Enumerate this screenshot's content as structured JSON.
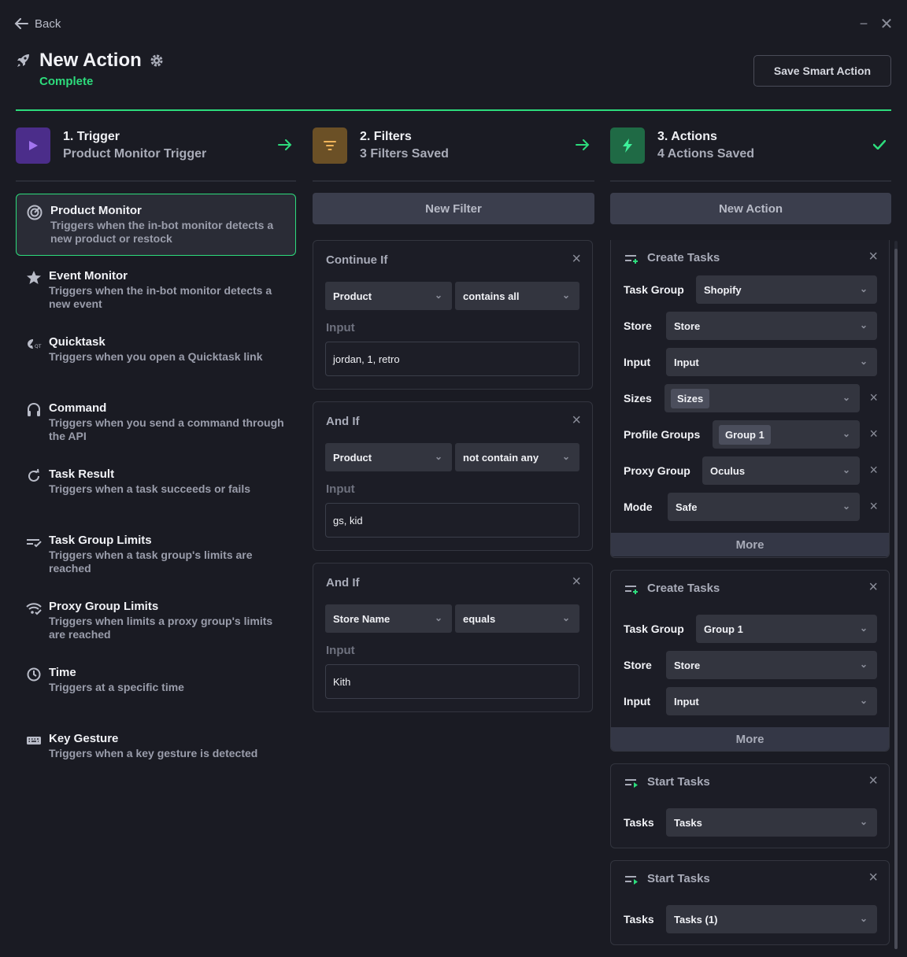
{
  "header": {
    "back_label": "Back",
    "title": "New Action",
    "status": "Complete",
    "save_label": "Save Smart Action",
    "minimize_glyph": "−",
    "close_glyph": "✕"
  },
  "steps": [
    {
      "title": "1. Trigger",
      "subtitle": "Product Monitor Trigger",
      "icon": "play-icon",
      "color": "#4b2d8a"
    },
    {
      "title": "2. Filters",
      "subtitle": "3 Filters Saved",
      "icon": "filter-icon",
      "color": "#6b5026"
    },
    {
      "title": "3. Actions",
      "subtitle": "4 Actions Saved",
      "icon": "bolt-icon",
      "color": "#1f6a45"
    }
  ],
  "triggers": [
    {
      "name": "Product Monitor",
      "description": "Triggers when the in-bot monitor detects a new product or restock",
      "icon": "target-icon",
      "selected": true
    },
    {
      "name": "Event Monitor",
      "description": "Triggers when the in-bot monitor detects a new event",
      "icon": "star-icon"
    },
    {
      "name": "Quicktask",
      "description": "Triggers when you open a Quicktask link",
      "icon": "quicktask-icon"
    },
    {
      "name": "Command",
      "description": "Triggers when you send a command through the API",
      "icon": "headset-icon"
    },
    {
      "name": "Task Result",
      "description": "Triggers when a task succeeds or fails",
      "icon": "refresh-icon"
    },
    {
      "name": "Task Group Limits",
      "description": "Triggers when a task group's limits are reached",
      "icon": "task-group-icon"
    },
    {
      "name": "Proxy Group Limits",
      "description": "Triggers when limits a proxy group's limits are reached",
      "icon": "wifi-icon"
    },
    {
      "name": "Time",
      "description": "Triggers at a specific time",
      "icon": "clock-icon"
    },
    {
      "name": "Key Gesture",
      "description": "Triggers when a key gesture is detected",
      "icon": "keyboard-icon"
    }
  ],
  "filters": {
    "new_label": "New Filter",
    "input_label": "Input",
    "items": [
      {
        "title": "Continue If",
        "field": "Product",
        "operator": "contains all",
        "value": "jordan, 1, retro"
      },
      {
        "title": "And If",
        "field": "Product",
        "operator": "not contain any",
        "value": "gs, kid"
      },
      {
        "title": "And If",
        "field": "Store Name",
        "operator": "equals",
        "value": "Kith"
      }
    ]
  },
  "actions": {
    "new_label": "New Action",
    "more_label": "More",
    "card1": {
      "title": "Create Tasks",
      "task_group_label": "Task Group",
      "task_group": "Shopify",
      "store_label": "Store",
      "store": "Store",
      "input_label": "Input",
      "input": "Input",
      "sizes_label": "Sizes",
      "sizes": "Sizes",
      "profile_label": "Profile Groups",
      "profile": "Group 1",
      "proxy_label": "Proxy Group",
      "proxy": "Oculus",
      "mode_label": "Mode",
      "mode": "Safe"
    },
    "card2": {
      "title": "Create Tasks",
      "task_group_label": "Task Group",
      "task_group": "Group 1",
      "store_label": "Store",
      "store": "Store",
      "input_label": "Input",
      "input": "Input"
    },
    "card3": {
      "title": "Start Tasks",
      "tasks_label": "Tasks",
      "tasks": "Tasks"
    },
    "card4": {
      "title": "Start Tasks",
      "tasks_label": "Tasks",
      "tasks": "Tasks (1)"
    }
  },
  "colors": {
    "accent": "#2ddc7c",
    "background": "#1a1b23",
    "panel": "#33353f"
  }
}
